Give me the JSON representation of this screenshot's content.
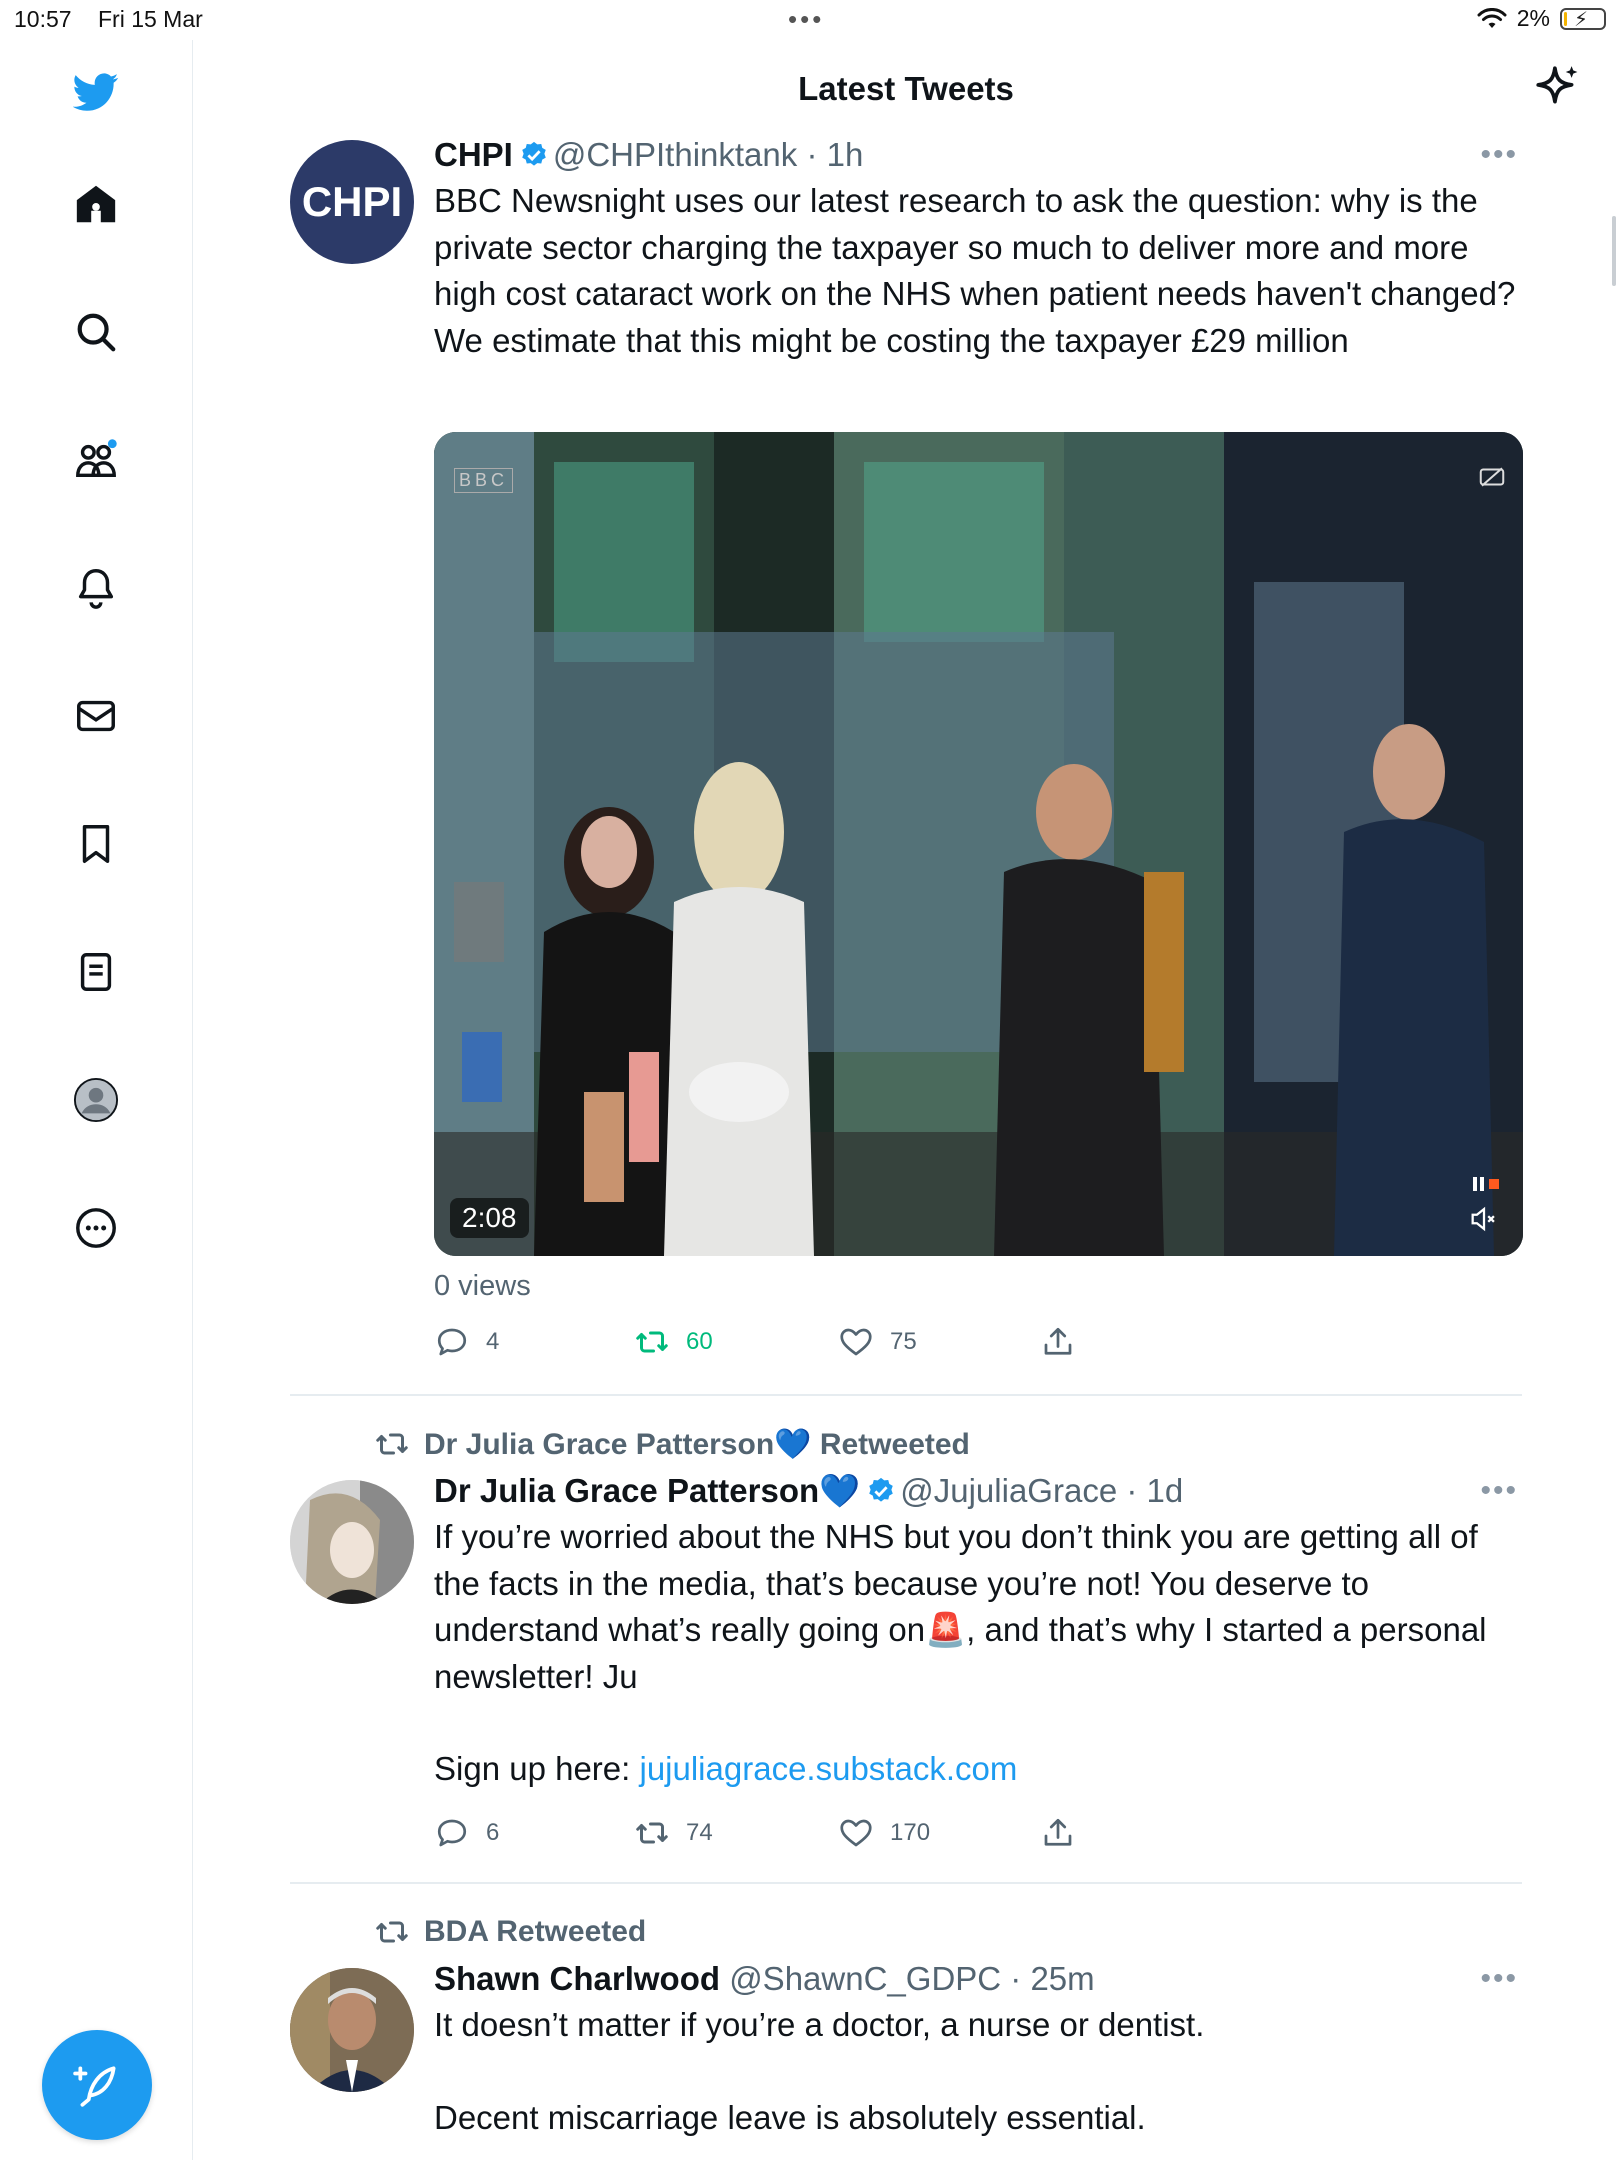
{
  "status_bar": {
    "time": "10:57",
    "date": "Fri 15 Mar",
    "battery": "2%"
  },
  "header": {
    "title": "Latest Tweets"
  },
  "sidebar": {
    "items": [
      {
        "icon": "home-icon"
      },
      {
        "icon": "search-icon"
      },
      {
        "icon": "communities-icon"
      },
      {
        "icon": "notifications-bell-icon"
      },
      {
        "icon": "messages-envelope-icon"
      },
      {
        "icon": "bookmark-icon"
      },
      {
        "icon": "lists-icon"
      },
      {
        "icon": "profile-avatar-icon"
      },
      {
        "icon": "more-circle-icon"
      }
    ],
    "compose_icon": "compose-feather-icon"
  },
  "tweets": [
    {
      "name": "CHPI",
      "handle": "@CHPIthinktank",
      "time": "· 1h",
      "avatar_text": "CHPI",
      "text": "BBC Newsnight uses our latest research to ask the question: why is the private sector charging the taxpayer so much to deliver more and more high cost cataract work on the NHS when patient needs haven't changed?  We estimate that this might be costing the taxpayer £29 million",
      "media": {
        "duration": "2:08",
        "logo": "BBC"
      },
      "views": "0 views",
      "replies": "4",
      "retweets": "60",
      "likes": "75"
    },
    {
      "retweeted_by": "Dr Julia Grace Patterson💙 Retweeted",
      "name": "Dr Julia Grace Patterson💙",
      "handle": "@JujuliaGrace",
      "time": "· 1d",
      "text_main": "If you’re worried about the NHS but you don’t think you are getting all of the facts in the media, that’s because you’re not! You deserve to understand what’s really going on🚨, and that’s why I started a personal newsletter! Ju",
      "signup_label": "Sign up here: ",
      "signup_link": "jujuliagrace.substack.com",
      "replies": "6",
      "retweets": "74",
      "likes": "170"
    },
    {
      "retweeted_by": "BDA Retweeted",
      "name": "Shawn Charlwood",
      "handle": "@ShawnC_GDPC",
      "time": "· 25m",
      "text_line1": "It doesn’t matter if you’re a doctor, a nurse or dentist.",
      "text_line2": "Decent miscarriage leave is absolutely essential."
    }
  ],
  "colors": {
    "accent": "#1d9bf0",
    "retweet_active": "#00ba7c",
    "text": "#0f1419",
    "muted": "#536471",
    "chpi_avatar": "#2c3a68"
  }
}
